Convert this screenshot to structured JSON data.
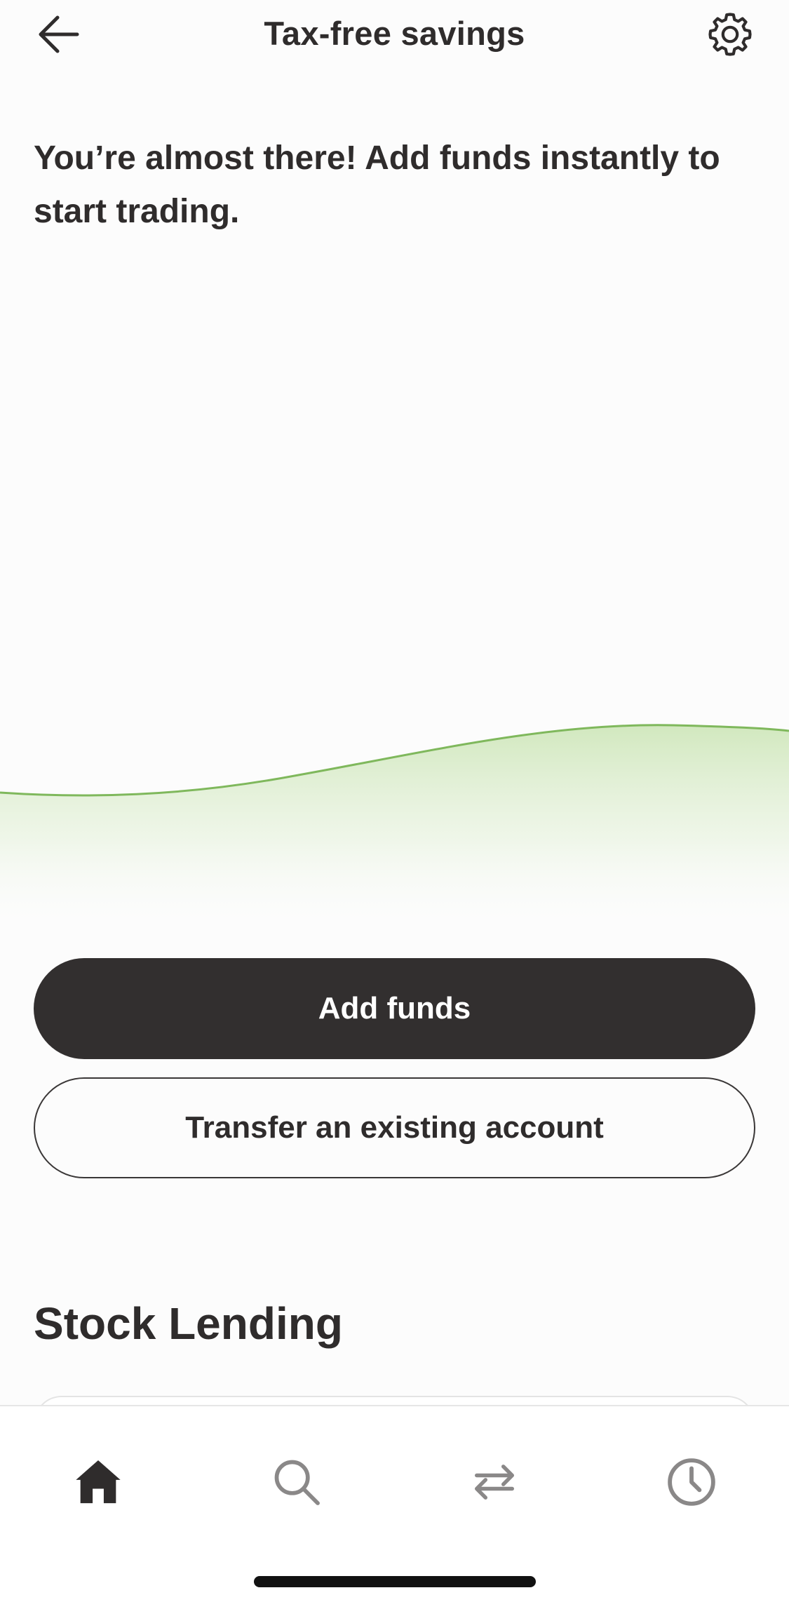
{
  "header": {
    "title": "Tax-free savings",
    "back_icon": "arrow-left-icon",
    "settings_icon": "gear-icon"
  },
  "intro": {
    "message": "You’re almost there! Add funds instantly to start trading."
  },
  "actions": {
    "add_funds_label": "Add funds",
    "transfer_label": "Transfer an existing account"
  },
  "section": {
    "title": "Stock Lending"
  },
  "bottom_nav": {
    "items": [
      {
        "icon": "home-icon",
        "active": true
      },
      {
        "icon": "search-icon",
        "active": false
      },
      {
        "icon": "transfer-arrows-icon",
        "active": false
      },
      {
        "icon": "clock-icon",
        "active": false
      }
    ]
  },
  "colors": {
    "text": "#2f2c2c",
    "primary_button": "#322f2f",
    "wave_line": "#7fb85c",
    "wave_fill": "#d8ecc7",
    "inactive_icon": "#8a8888"
  }
}
